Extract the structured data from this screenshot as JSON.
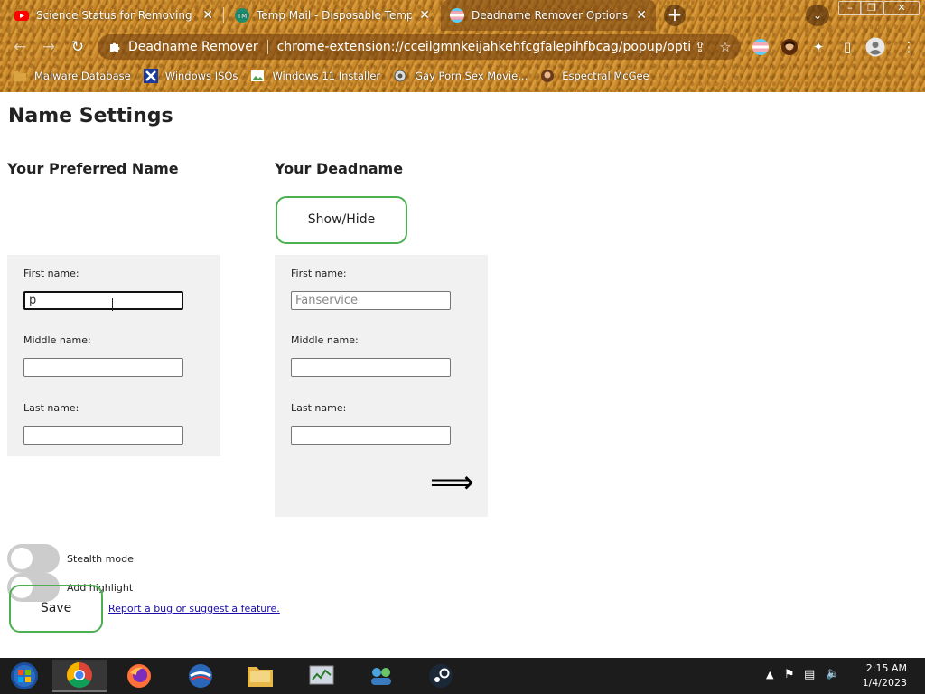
{
  "browser": {
    "tabs": [
      {
        "title": "Science Status for Removing Porn",
        "icon": "youtube-icon",
        "active": false
      },
      {
        "title": "Temp Mail - Disposable Temporary",
        "icon": "tempmail-icon",
        "active": false
      },
      {
        "title": "Deadname Remover Options",
        "icon": "trans-flag-icon",
        "active": true
      }
    ],
    "address_bar": {
      "site_label": "Deadname Remover",
      "url": "chrome-extension://cceilgmnkeijahkehfcgfalepihfbcag/popup/option..."
    },
    "bookmarks": [
      {
        "label": "Malware Database",
        "icon": "folder-icon"
      },
      {
        "label": "Windows ISOs",
        "icon": "x-logo-icon"
      },
      {
        "label": "Windows 11 Installer",
        "icon": "image-icon"
      },
      {
        "label": "Gay Porn Sex Movie...",
        "icon": "gear-icon"
      },
      {
        "label": "Espectral McGee",
        "icon": "avatar-icon"
      }
    ]
  },
  "page": {
    "title": "Name Settings",
    "preferred": {
      "heading": "Your Preferred Name",
      "first_label": "First name:",
      "first_value": "p",
      "middle_label": "Middle name:",
      "middle_value": "",
      "last_label": "Last name:",
      "last_value": ""
    },
    "deadname": {
      "heading": "Your Deadname",
      "show_hide_label": "Show/Hide",
      "first_label": "First name:",
      "first_placeholder": "Fanservice",
      "middle_label": "Middle name:",
      "last_label": "Last name:",
      "arrow": "⟹"
    },
    "toggles": [
      {
        "label": "Stealth mode",
        "on": false
      },
      {
        "label": "Add highlight",
        "on": false
      }
    ],
    "save_label": "Save",
    "bug_link": "Report a bug or suggest a feature."
  },
  "taskbar": {
    "time": "2:15 AM",
    "date": "1/4/2023"
  },
  "colors": {
    "accent_green": "#4caf50",
    "panel_bg": "#f1f1f1",
    "chrome_brown": "#c4842a"
  }
}
